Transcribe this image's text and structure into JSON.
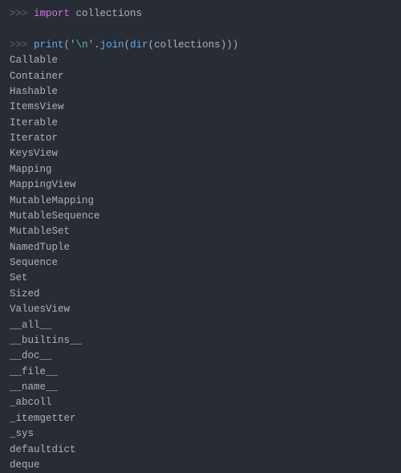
{
  "prompt": ">>> ",
  "line1": {
    "keyword": "import",
    "space": " ",
    "module": "collections"
  },
  "line2": {
    "func_print": "print",
    "paren_open1": "(",
    "str_open": "'",
    "escape": "\\n",
    "str_close": "'",
    "dot": ".",
    "method": "join",
    "paren_open2": "(",
    "func_dir": "dir",
    "paren_open3": "(",
    "arg": "collections",
    "paren_close3": ")",
    "paren_close2": ")",
    "paren_close1": ")"
  },
  "output": [
    "Callable",
    "Container",
    "Hashable",
    "ItemsView",
    "Iterable",
    "Iterator",
    "KeysView",
    "Mapping",
    "MappingView",
    "MutableMapping",
    "MutableSequence",
    "MutableSet",
    "NamedTuple",
    "Sequence",
    "Set",
    "Sized",
    "ValuesView",
    "__all__",
    "__builtins__",
    "__doc__",
    "__file__",
    "__name__",
    "_abcoll",
    "_itemgetter",
    "_sys",
    "defaultdict",
    "deque"
  ]
}
